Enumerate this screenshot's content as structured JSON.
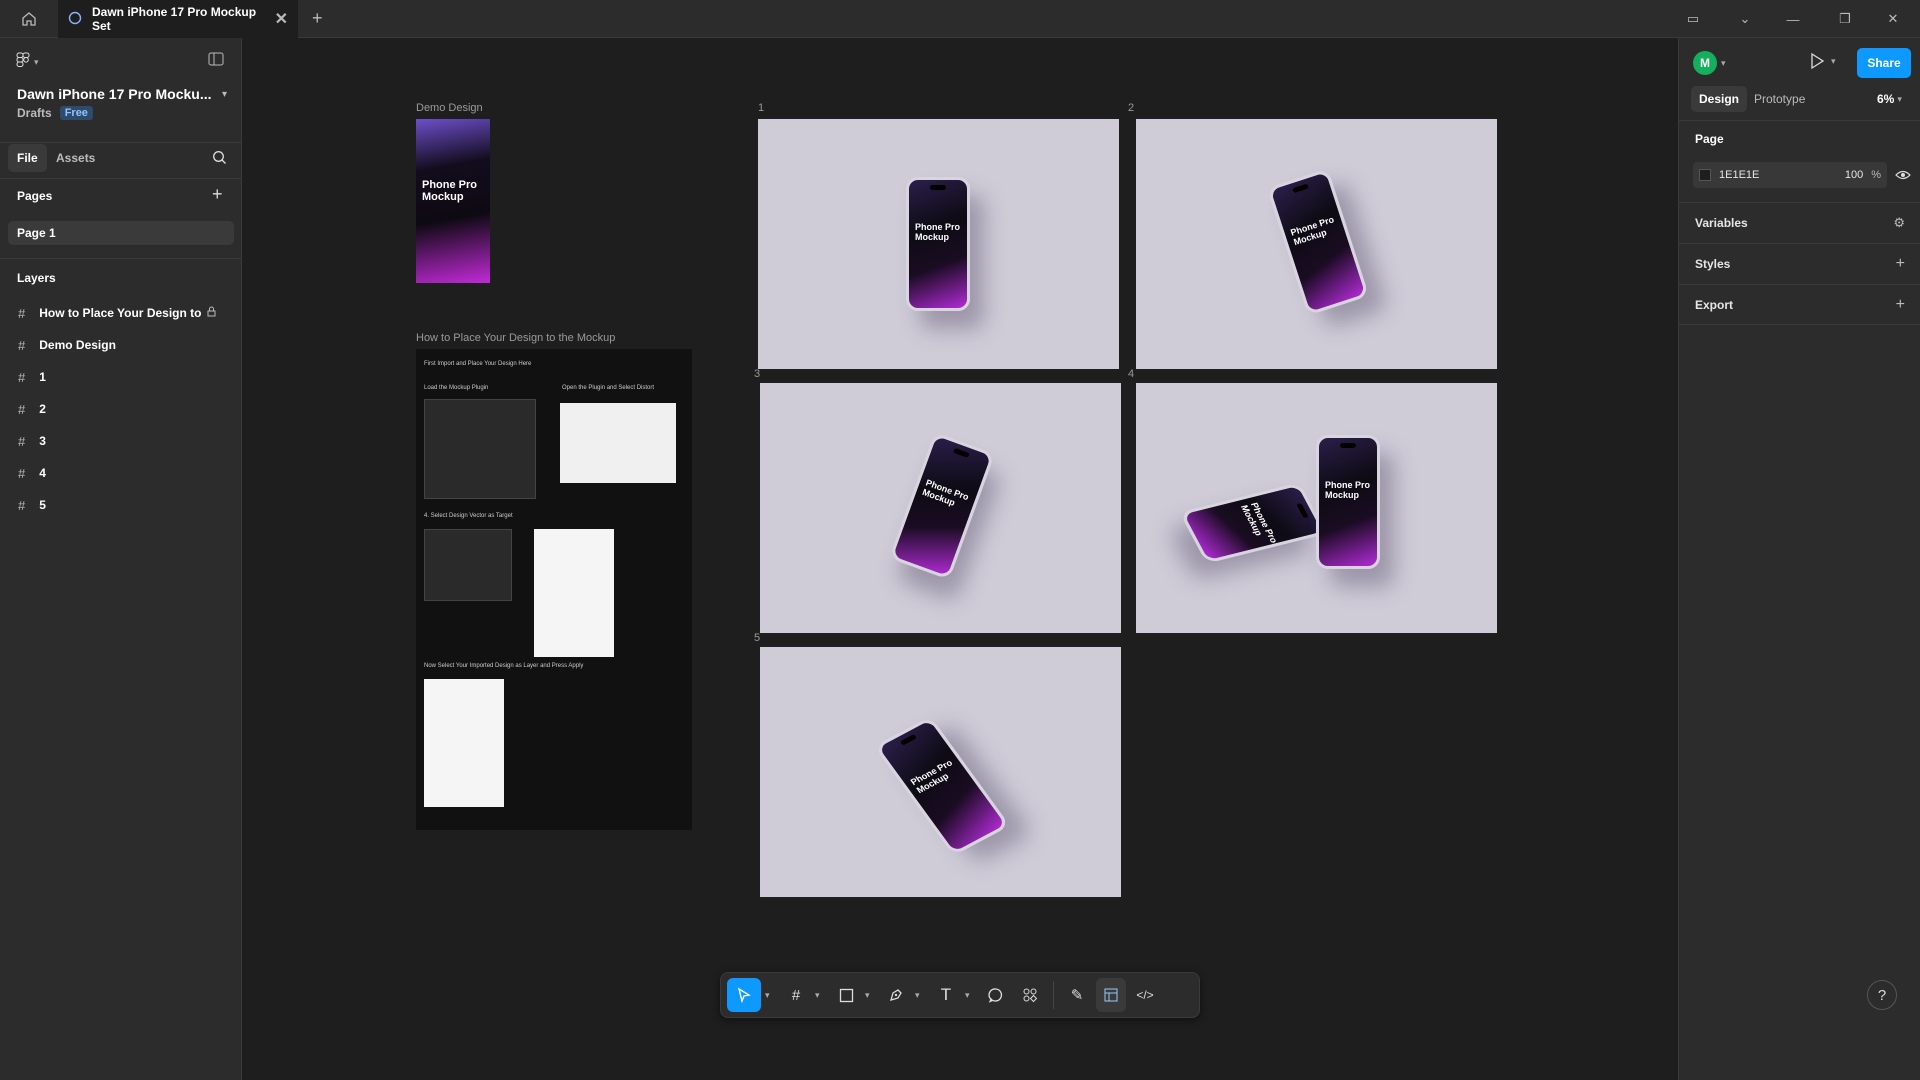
{
  "tabs": {
    "home_icon": "home-icon",
    "active_tab": "Dawn iPhone 17 Pro Mockup Set",
    "close": "✕",
    "new_tab": "+"
  },
  "left": {
    "file_name": "Dawn iPhone 17 Pro Mocku...",
    "location": "Drafts",
    "plan_badge": "Free",
    "tab_file": "File",
    "tab_assets": "Assets",
    "pages_heading": "Pages",
    "pages": [
      "Page 1"
    ],
    "layers_heading": "Layers",
    "layers": [
      "How to Place Your Design to",
      "Demo Design",
      "1",
      "2",
      "3",
      "4",
      "5"
    ]
  },
  "right": {
    "avatar_letter": "M",
    "share": "Share",
    "tab_design": "Design",
    "tab_prototype": "Prototype",
    "zoom": "6%",
    "page_heading": "Page",
    "page_color": "1E1E1E",
    "page_opacity": "100",
    "percent": "%",
    "variables": "Variables",
    "styles": "Styles",
    "export": "Export",
    "accent_color": "#0d99ff"
  },
  "canvas": {
    "demo_label": "Demo Design",
    "howto_label": "How to Place Your Design to the Mockup",
    "phone_text": "Phone Pro Mockup",
    "howto_steps": [
      "First Import and Place Your Design Here",
      "Load the Mockup Plugin",
      "Open the Plugin and Select Distort",
      "4. Select Design Vector as Target",
      "Now Select Your Imported Design as Layer and Press Apply"
    ],
    "frames": [
      "1",
      "2",
      "3",
      "4",
      "5"
    ]
  },
  "help": "?"
}
